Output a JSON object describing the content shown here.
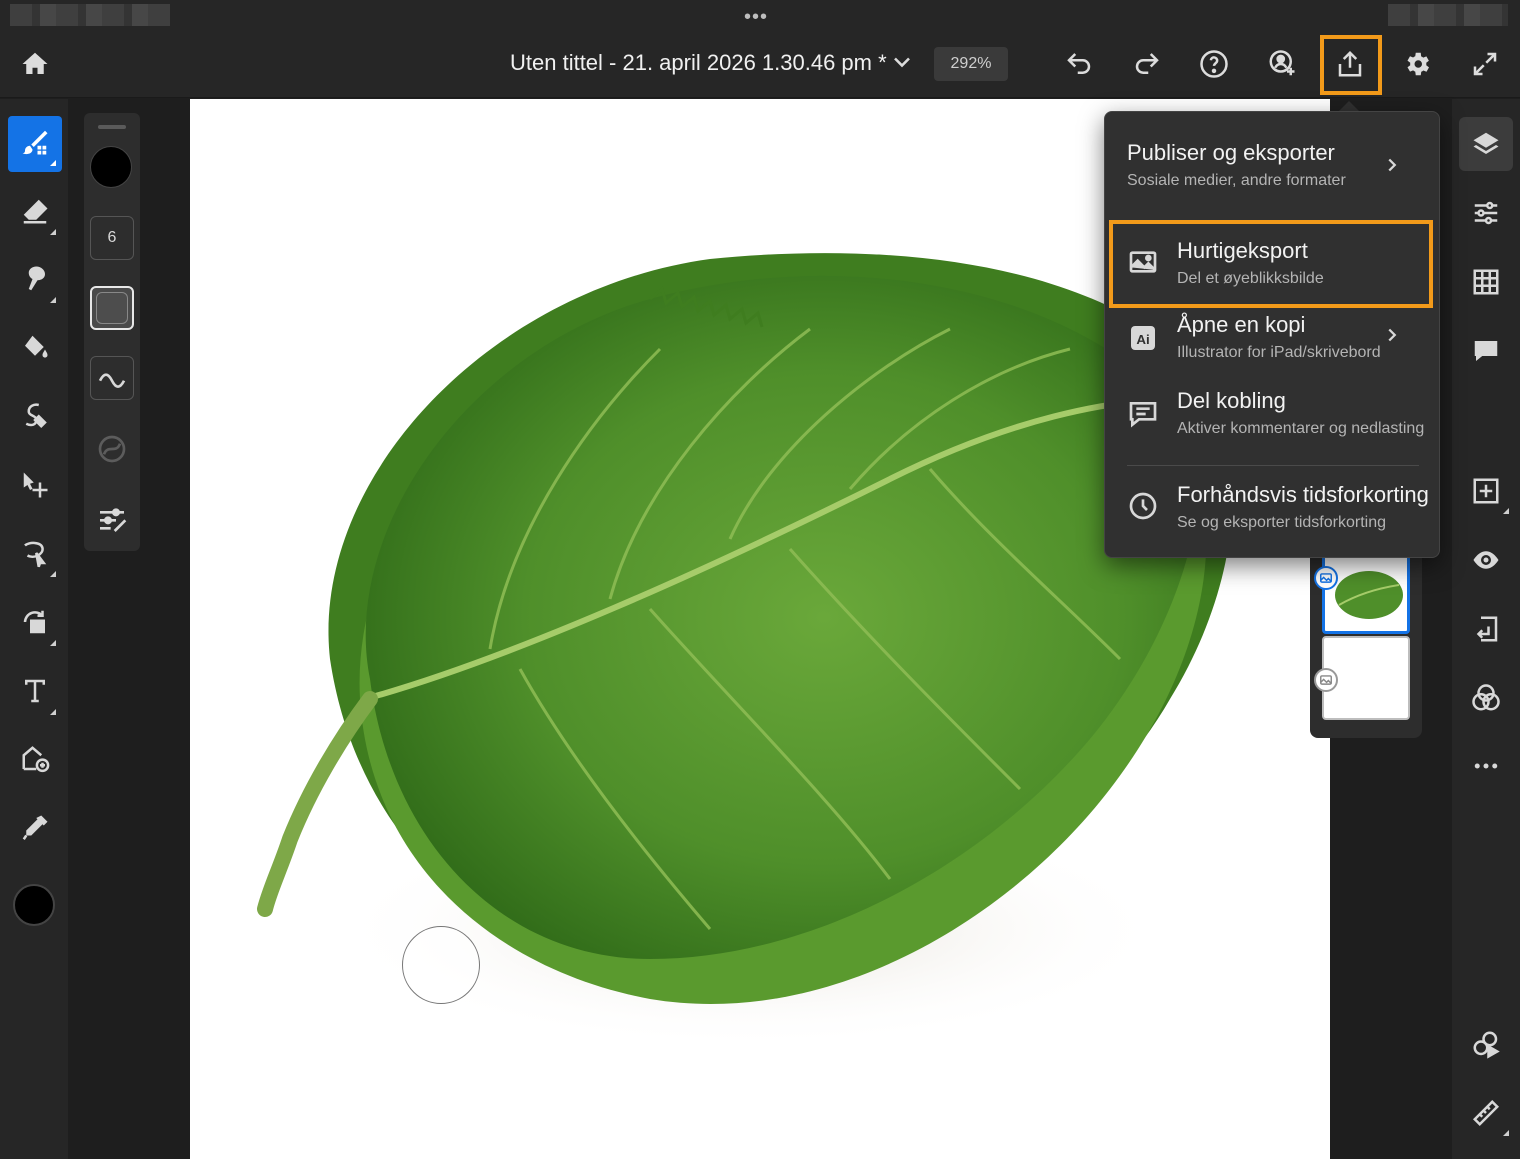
{
  "header": {
    "document_title": "Uten tittel - 21. april 2026 1.30.46 pm *",
    "zoom_level": "292%"
  },
  "tool_options": {
    "brush_size": "6"
  },
  "share_menu": {
    "items": [
      {
        "title": "Publiser og eksporter",
        "subtitle": "Sosiale medier, andre formater",
        "icon": "none",
        "has_submenu": true
      },
      {
        "title": "Hurtigeksport",
        "subtitle": "Del et øyeblikksbilde",
        "icon": "image-icon",
        "has_submenu": false,
        "highlighted": true
      },
      {
        "title": "Åpne en kopi",
        "subtitle": "Illustrator for iPad/skrivebord",
        "icon": "illustrator-icon",
        "icon_text": "Ai",
        "has_submenu": true
      },
      {
        "title": "Del kobling",
        "subtitle": "Aktiver kommentarer og nedlasting",
        "icon": "comment-icon",
        "has_submenu": false
      },
      {
        "title": "Forhåndsvis tidsforkorting",
        "subtitle": "Se og eksporter tidsforkorting",
        "icon": "clock-icon",
        "has_submenu": false
      }
    ]
  },
  "colors": {
    "accent_blue": "#1473e6",
    "highlight_orange": "#f29a1a",
    "leaf_green": "#4f8f2a"
  },
  "icons": {
    "header": [
      "home-icon",
      "chevron-down-icon",
      "undo-icon",
      "redo-icon",
      "help-icon",
      "invite-user-icon",
      "share-icon",
      "settings-icon",
      "fullscreen-icon"
    ],
    "left_toolbar": [
      "brush-icon",
      "eraser-icon",
      "smudge-icon",
      "fill-icon",
      "lasso-heal-icon",
      "move-icon",
      "select-icon",
      "transform-icon",
      "type-icon",
      "add-image-icon",
      "eyedropper-icon"
    ],
    "right_toolbar": [
      "layers-icon",
      "adjustments-icon",
      "grid-icon",
      "comment-icon",
      "add-layer-icon",
      "visibility-icon",
      "import-icon",
      "blend-icon",
      "more-icon",
      "effects-icon",
      "ruler-icon"
    ]
  }
}
